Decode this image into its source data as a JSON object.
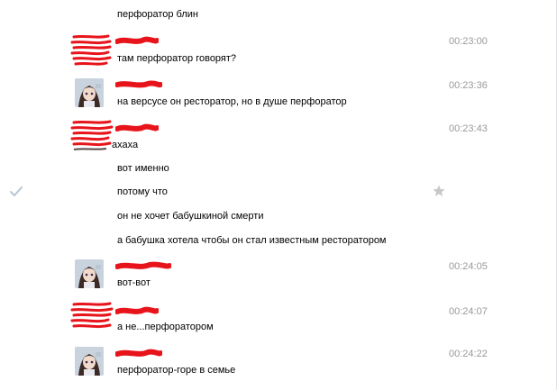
{
  "messages": [
    {
      "text": "перфоратор блин"
    },
    {
      "text": "там перфоратор говорят?",
      "time": "00:23:00"
    },
    {
      "text": "на версусе он ресторатор, но в душе перфоратор",
      "time": "00:23:36"
    },
    {
      "text": "ахаха",
      "time": "00:23:43"
    },
    {
      "text": "вот именно"
    },
    {
      "text": "потому что"
    },
    {
      "text": "он не хочет бабушкиной смерти"
    },
    {
      "text": "а бабушка хотела чтобы он стал известным ресторатором"
    },
    {
      "text": "вот-вот",
      "time": "00:24:05"
    },
    {
      "text": "а не...перфоратором",
      "time": "00:24:07"
    },
    {
      "text": "перфоратор-горе в семье",
      "time": "00:24:22"
    }
  ],
  "colors": {
    "timestamp": "#999999",
    "redaction": "#e8141b",
    "link": "#2b587a"
  },
  "icons": {
    "check": "check-icon",
    "star": "star-icon"
  }
}
